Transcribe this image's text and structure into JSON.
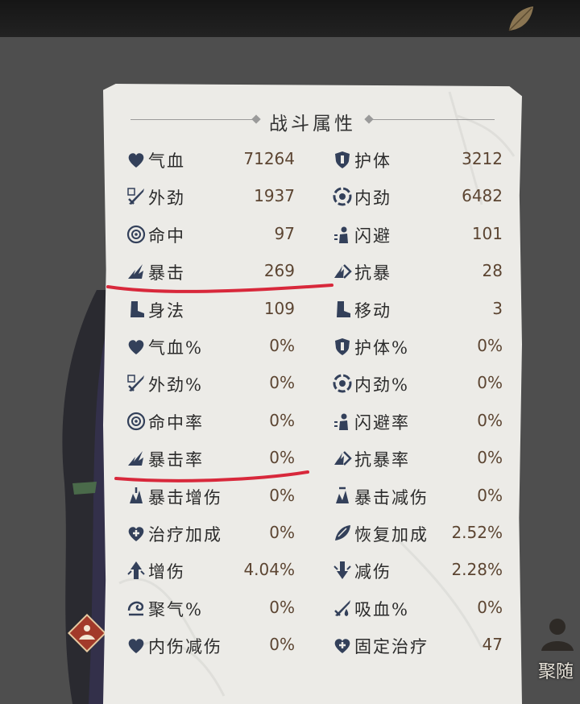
{
  "panel": {
    "title": "战斗属性"
  },
  "stats_left": [
    {
      "label": "气血",
      "value": "71264",
      "icon": "heart-icon"
    },
    {
      "label": "外劲",
      "value": "1937",
      "icon": "sword-icon"
    },
    {
      "label": "命中",
      "value": "97",
      "icon": "target-icon"
    },
    {
      "label": "暴击",
      "value": "269",
      "icon": "crit-icon"
    },
    {
      "label": "身法",
      "value": "109",
      "icon": "boot-icon"
    },
    {
      "label": "气血%",
      "value": "0%",
      "icon": "heart-icon"
    },
    {
      "label": "外劲%",
      "value": "0%",
      "icon": "sword-icon"
    },
    {
      "label": "命中率",
      "value": "0%",
      "icon": "target-icon"
    },
    {
      "label": "暴击率",
      "value": "0%",
      "icon": "crit-icon"
    },
    {
      "label": "暴击增伤",
      "value": "0%",
      "icon": "crit-damage-icon"
    },
    {
      "label": "治疗加成",
      "value": "0%",
      "icon": "heal-heart-icon"
    },
    {
      "label": "增伤",
      "value": "4.04%",
      "icon": "damage-up-icon"
    },
    {
      "label": "聚气%",
      "value": "0%",
      "icon": "gather-qi-icon"
    },
    {
      "label": "内伤减伤",
      "value": "0%",
      "icon": "heart-icon"
    }
  ],
  "stats_right": [
    {
      "label": "护体",
      "value": "3212",
      "icon": "shield-icon"
    },
    {
      "label": "内劲",
      "value": "6482",
      "icon": "swirl-icon"
    },
    {
      "label": "闪避",
      "value": "101",
      "icon": "dodge-icon"
    },
    {
      "label": "抗暴",
      "value": "28",
      "icon": "crit-resist-icon"
    },
    {
      "label": "移动",
      "value": "3",
      "icon": "boot-icon"
    },
    {
      "label": "护体%",
      "value": "0%",
      "icon": "shield-icon"
    },
    {
      "label": "内劲%",
      "value": "0%",
      "icon": "swirl-icon"
    },
    {
      "label": "闪避率",
      "value": "0%",
      "icon": "dodge-icon"
    },
    {
      "label": "抗暴率",
      "value": "0%",
      "icon": "crit-resist-icon"
    },
    {
      "label": "暴击减伤",
      "value": "0%",
      "icon": "crit-reduce-icon"
    },
    {
      "label": "恢复加成",
      "value": "2.52%",
      "icon": "recover-icon"
    },
    {
      "label": "减伤",
      "value": "2.28%",
      "icon": "damage-down-icon"
    },
    {
      "label": "吸血%",
      "value": "0%",
      "icon": "lifesteal-icon"
    },
    {
      "label": "固定治疗",
      "value": "47",
      "icon": "heal-heart-icon"
    }
  ],
  "side": {
    "right_label": "聚随"
  },
  "colors": {
    "annotation_red": "#d8283b",
    "paper": "#ecebe7",
    "value_text": "#5c4532",
    "icon": "#33405a"
  }
}
